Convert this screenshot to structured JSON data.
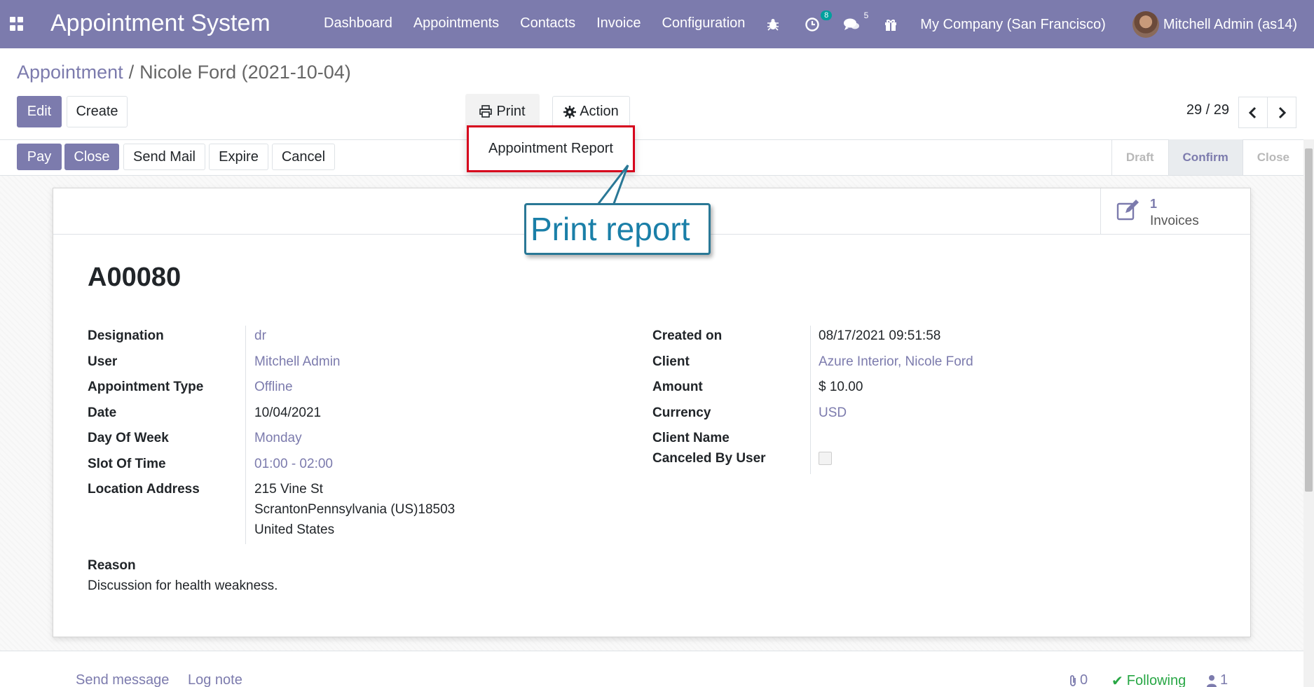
{
  "navbar": {
    "app_title": "Appointment System",
    "menu": [
      "Dashboard",
      "Appointments",
      "Contacts",
      "Invoice",
      "Configuration"
    ],
    "activity_count": "8",
    "message_count": "5",
    "company": "My Company (San Francisco)",
    "user": "Mitchell Admin (as14)"
  },
  "breadcrumb": {
    "parent": "Appointment",
    "separator": "/",
    "current": "Nicole Ford (2021-10-04)"
  },
  "control": {
    "edit_label": "Edit",
    "create_label": "Create",
    "print_label": "Print",
    "action_label": "Action",
    "pager": "29 / 29"
  },
  "print_menu": {
    "items": [
      "Appointment Report"
    ]
  },
  "statusbar": {
    "buttons": [
      "Pay",
      "Close",
      "Send Mail",
      "Expire",
      "Cancel"
    ],
    "stages": [
      "Draft",
      "Confirm",
      "Close"
    ],
    "active_stage": "Confirm"
  },
  "smart_button": {
    "value": "1",
    "label": "Invoices"
  },
  "callout": {
    "text": "Print report"
  },
  "record": {
    "name": "A00080",
    "left_fields": [
      {
        "label": "Designation",
        "value": "dr"
      },
      {
        "label": "User",
        "value": "Mitchell Admin"
      },
      {
        "label": "Appointment Type",
        "value": "Offline"
      },
      {
        "label": "Date",
        "value": "10/04/2021"
      },
      {
        "label": "Day Of Week",
        "value": "Monday"
      },
      {
        "label": "Slot Of Time",
        "value": "01:00 - 02:00"
      },
      {
        "label": "Location Address",
        "value": "215 Vine St"
      }
    ],
    "address_line2": "ScrantonPennsylvania (US)18503",
    "address_line3": "United States",
    "right_fields": [
      {
        "label": "Created on",
        "value": "08/17/2021 09:51:58"
      },
      {
        "label": "Client",
        "value": "Azure Interior, Nicole Ford"
      },
      {
        "label": "Amount",
        "value": "$ 10.00"
      },
      {
        "label": "Currency",
        "value": "USD"
      },
      {
        "label": "Client Name",
        "value": ""
      },
      {
        "label": "Canceled By User",
        "value": ""
      }
    ],
    "reason_label": "Reason",
    "reason_value": "Discussion for health weakness."
  },
  "chatter": {
    "send_message": "Send message",
    "log_note": "Log note",
    "attachments": "0",
    "following": "Following",
    "followers": "1"
  },
  "colors": {
    "brand": "#7c7bad",
    "highlight": "#d6001c",
    "callout": "#1a7fa8"
  }
}
